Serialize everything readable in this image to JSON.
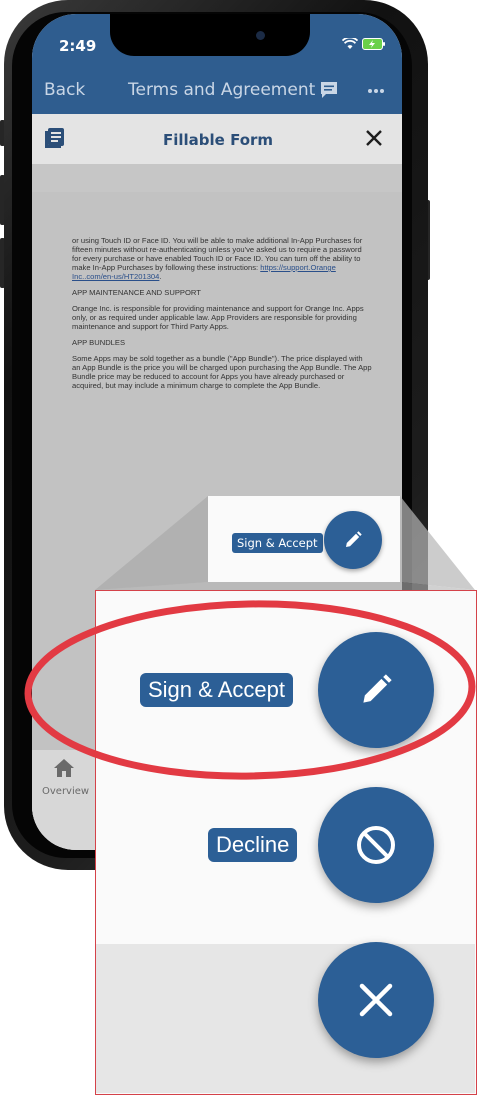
{
  "status_bar": {
    "time": "2:49"
  },
  "nav": {
    "back_label": "Back",
    "title": "Terms and Agreement"
  },
  "sheet": {
    "title": "Fillable Form"
  },
  "document": {
    "para1": "or using Touch ID or Face ID. You will be able to make additional In-App Purchases for fifteen minutes without re-authenticating unless you've asked us to require a password for every purchase or have enabled Touch ID or Face ID. You can turn off the ability to make In-App Purchases by following these instructions: ",
    "link": "https://support.Orange Inc..com/en-us/HT201304",
    "heading1": "APP MAINTENANCE AND SUPPORT",
    "para2": "Orange Inc. is responsible for providing maintenance and support for Orange Inc. Apps only, or as required under applicable law. App Providers are responsible for providing maintenance and support for Third Party Apps.",
    "heading2": "APP BUNDLES",
    "para3": "Some Apps may be sold together as a bundle (\"App Bundle\"). The price displayed with an App Bundle is the price you will be charged upon purchasing the App Bundle. The App Bundle price may be reduced to account for Apps you have already purchased or acquired, but may include a minimum charge to complete the App Bundle."
  },
  "tabbar": {
    "overview_label": "Overview"
  },
  "actions": {
    "sign_accept_label": "Sign & Accept",
    "decline_label": "Decline"
  },
  "colors": {
    "brand": "#2c5f96",
    "highlight": "#e23a43",
    "nav": "#2f5d8f"
  }
}
